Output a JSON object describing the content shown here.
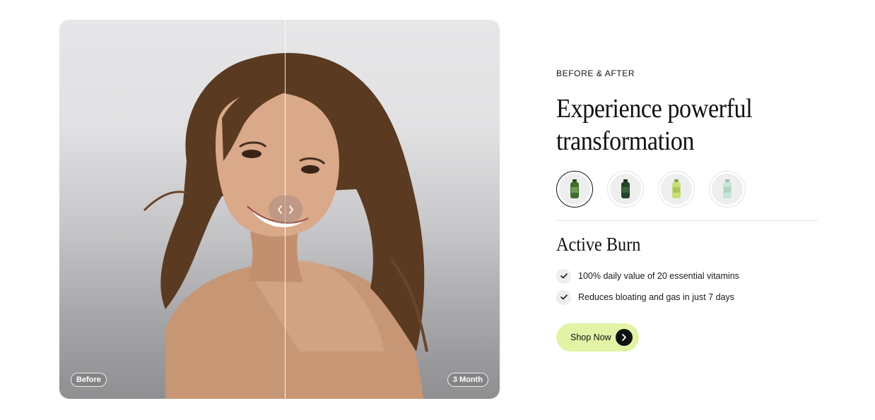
{
  "comparison": {
    "before_label": "Before",
    "after_label": "3 Month",
    "slider_position": 0.51
  },
  "section": {
    "eyebrow": "BEFORE & AFTER",
    "headline": "Experience powerful transformation"
  },
  "products": {
    "options": [
      {
        "name": "bottle-dark-green-icon",
        "color": "#3f6e2e",
        "selected": true
      },
      {
        "name": "bottle-forest-green-icon",
        "color": "#24442a",
        "selected": false
      },
      {
        "name": "bottle-lime-icon",
        "color": "#c9e07a",
        "selected": false
      },
      {
        "name": "bottle-mint-icon",
        "color": "#c8e4d6",
        "selected": false
      }
    ],
    "active_name": "Active Burn",
    "features": [
      "100% daily value of 20 essential vitamins",
      "Reduces bloating and gas in just 7 days"
    ]
  },
  "cta": {
    "label": "Shop Now",
    "color": "#e2f3a6"
  }
}
